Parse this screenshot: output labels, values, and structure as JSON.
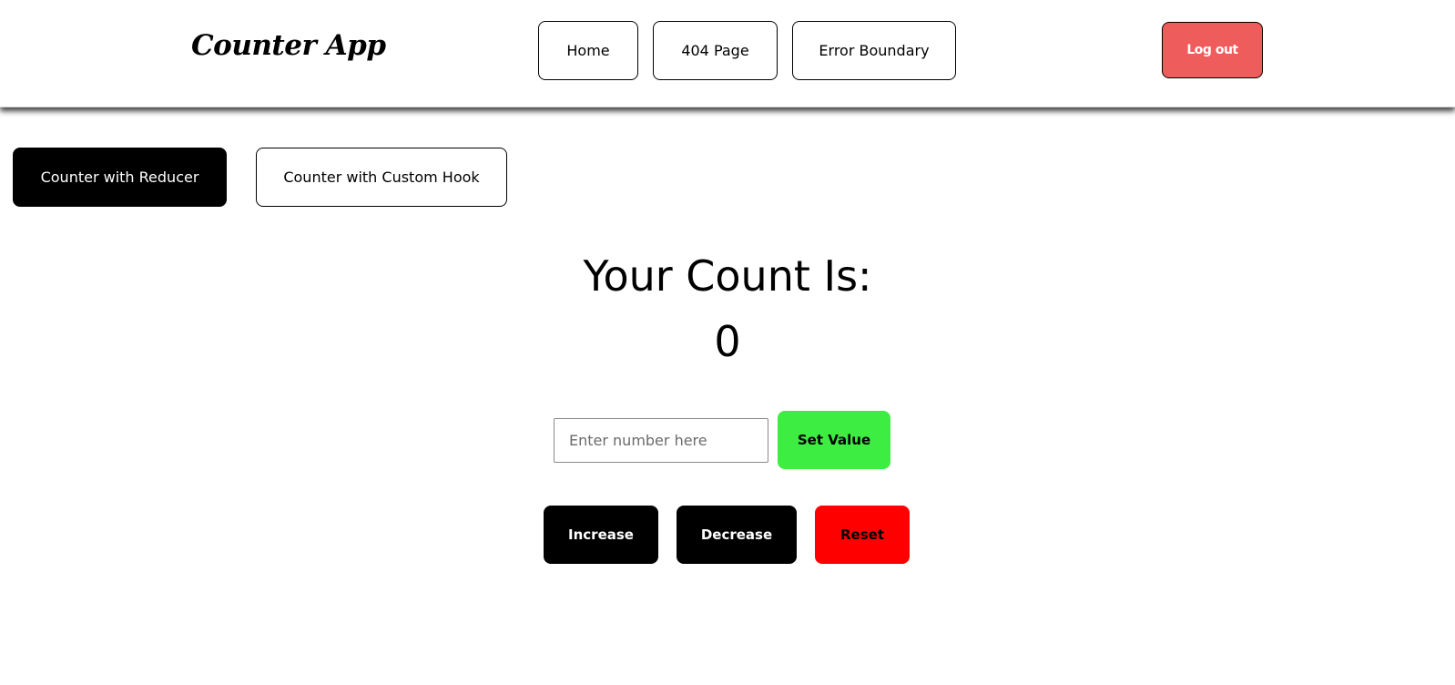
{
  "header": {
    "logo": "Counter App",
    "nav": [
      {
        "label": "Home"
      },
      {
        "label": "404 Page"
      },
      {
        "label": "Error Boundary"
      }
    ],
    "logout_label": "Log out"
  },
  "tabs": [
    {
      "label": "Counter with Reducer",
      "active": true
    },
    {
      "label": "Counter with Custom Hook",
      "active": false
    }
  ],
  "counter": {
    "title": "Your Count Is:",
    "value": "0"
  },
  "input": {
    "value": "",
    "placeholder": "Enter number here",
    "set_label": "Set Value"
  },
  "actions": {
    "increase_label": "Increase",
    "decrease_label": "Decrease",
    "reset_label": "Reset"
  },
  "colors": {
    "logout_bg": "#ef5c5c",
    "set_value_bg": "#3ded42",
    "reset_bg": "#ff0000",
    "active_tab_bg": "#000000"
  }
}
